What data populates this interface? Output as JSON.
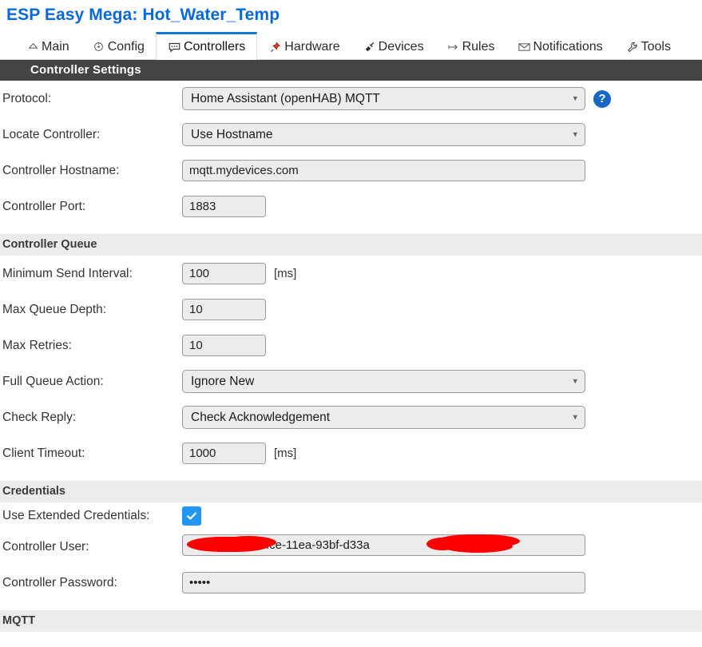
{
  "page": {
    "title": "ESP Easy Mega: Hot_Water_Temp"
  },
  "tabs": [
    {
      "label": "Main",
      "icon": "home-icon",
      "glyph": "⌂",
      "active": false
    },
    {
      "label": "Config",
      "icon": "gear-icon",
      "glyph": "⊙",
      "active": false
    },
    {
      "label": "Controllers",
      "icon": "speech-bubble-icon",
      "glyph": "⌨",
      "active": true
    },
    {
      "label": "Hardware",
      "icon": "pushpin-icon",
      "glyph": "ὌC",
      "active": false
    },
    {
      "label": "Devices",
      "icon": "plug-icon",
      "glyph": "ὐC",
      "active": false
    },
    {
      "label": "Rules",
      "icon": "arrow-icon",
      "glyph": "↦",
      "active": false
    },
    {
      "label": "Notifications",
      "icon": "envelope-icon",
      "glyph": "✉",
      "active": false
    },
    {
      "label": "Tools",
      "icon": "wrench-icon",
      "glyph": "ὒ7",
      "active": false
    }
  ],
  "sections": {
    "controller_settings": {
      "header": "Controller Settings",
      "protocol": {
        "label": "Protocol:",
        "value": "Home Assistant (openHAB) MQTT",
        "options": [
          "Home Assistant (openHAB) MQTT"
        ],
        "help_glyph": "?"
      },
      "locate_controller": {
        "label": "Locate Controller:",
        "value": "Use Hostname",
        "options": [
          "Use Hostname"
        ]
      },
      "controller_hostname": {
        "label": "Controller Hostname:",
        "value": "mqtt.mydevices.com"
      },
      "controller_port": {
        "label": "Controller Port:",
        "value": "1883"
      }
    },
    "controller_queue": {
      "header": "Controller Queue",
      "minimum_send_interval": {
        "label": "Minimum Send Interval:",
        "value": "100",
        "unit": "[ms]"
      },
      "max_queue_depth": {
        "label": "Max Queue Depth:",
        "value": "10"
      },
      "max_retries": {
        "label": "Max Retries:",
        "value": "10"
      },
      "full_queue_action": {
        "label": "Full Queue Action:",
        "value": "Ignore New",
        "options": [
          "Ignore New"
        ]
      },
      "check_reply": {
        "label": "Check Reply:",
        "value": "Check Acknowledgement",
        "options": [
          "Check Acknowledgement"
        ]
      },
      "client_timeout": {
        "label": "Client Timeout:",
        "value": "1000",
        "unit": "[ms]"
      }
    },
    "credentials": {
      "header": "Credentials",
      "use_extended_credentials": {
        "label": "Use Extended Credentials:",
        "checked": true
      },
      "controller_user": {
        "label": "Controller User:",
        "visible_value": "fce-11ea-93bf-d33a",
        "redacted": true
      },
      "controller_password": {
        "label": "Controller Password:",
        "value": "•••••"
      }
    },
    "mqtt": {
      "header": "MQTT"
    }
  },
  "colors": {
    "title": "#0a68d8",
    "dark_header_bg": "#444444",
    "sub_header_bg": "#ececec",
    "accent_tab": "#1878d0",
    "checkbox": "#2196f3",
    "help_icon": "#1668c4",
    "redaction": "#fe0000",
    "field_bg": "#ececec"
  }
}
